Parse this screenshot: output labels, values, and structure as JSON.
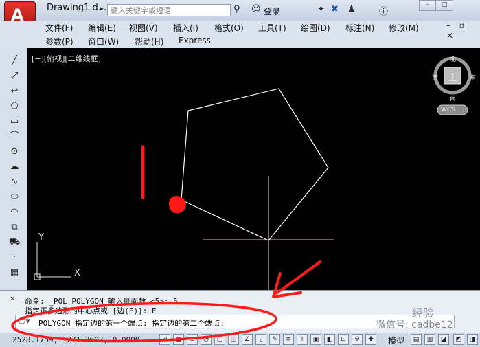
{
  "window": {
    "title": "Drawing1.d...",
    "search_placeholder": "键入关键字或短语",
    "login_label": "登录",
    "min_label": "–",
    "max_label": "□"
  },
  "menu_row1": [
    "文件(F)",
    "编辑(E)",
    "视图(V)",
    "插入(I)",
    "格式(O)",
    "工具(T)",
    "绘图(D)",
    "标注(N)",
    "修改(M)"
  ],
  "menu_row2": [
    "参数(P)",
    "窗口(W)",
    "帮助(H)",
    "Express"
  ],
  "viewport": {
    "label": "[−][俯视][二维线框]",
    "viewcube": {
      "north": "北",
      "south": "南",
      "east": "东",
      "west": "西",
      "top": "上",
      "wcs": "WCS"
    },
    "ucs": {
      "x": "X",
      "y": "Y"
    }
  },
  "command": {
    "history_line1": "命令: _POL POLYGON 输入侧面数 <5>: 5",
    "history_line2": "指定正多边形的中心点或 [边(E)]: E",
    "prompt": "POLYGON 指定边的第一个端点: 指定边的第二个端点:"
  },
  "status": {
    "coords": "2528.1759, 1271.2602, 0.0000",
    "model_label": "模型"
  },
  "watermark": {
    "line1": "经验",
    "line2": "微信号: cadbe12"
  },
  "colors": {
    "canvas_bg": "#000000",
    "polygon_stroke": "#ffffff",
    "annotation_red": "#ff1a1a",
    "app_red": "#c0241d"
  },
  "icons": [
    "autocad-logo-icon",
    "binoculars-icon",
    "user-icon",
    "star-icon",
    "exchange-icon",
    "help-icon",
    "line-icon",
    "construction-line-icon",
    "polyline-icon",
    "polygon-icon",
    "rectangle-icon",
    "arc-icon",
    "circle-icon",
    "revcloud-icon",
    "spline-icon",
    "ellipse-icon",
    "ellipse-arc-icon",
    "insert-block-icon",
    "make-block-icon",
    "point-icon",
    "hatch-icon"
  ]
}
